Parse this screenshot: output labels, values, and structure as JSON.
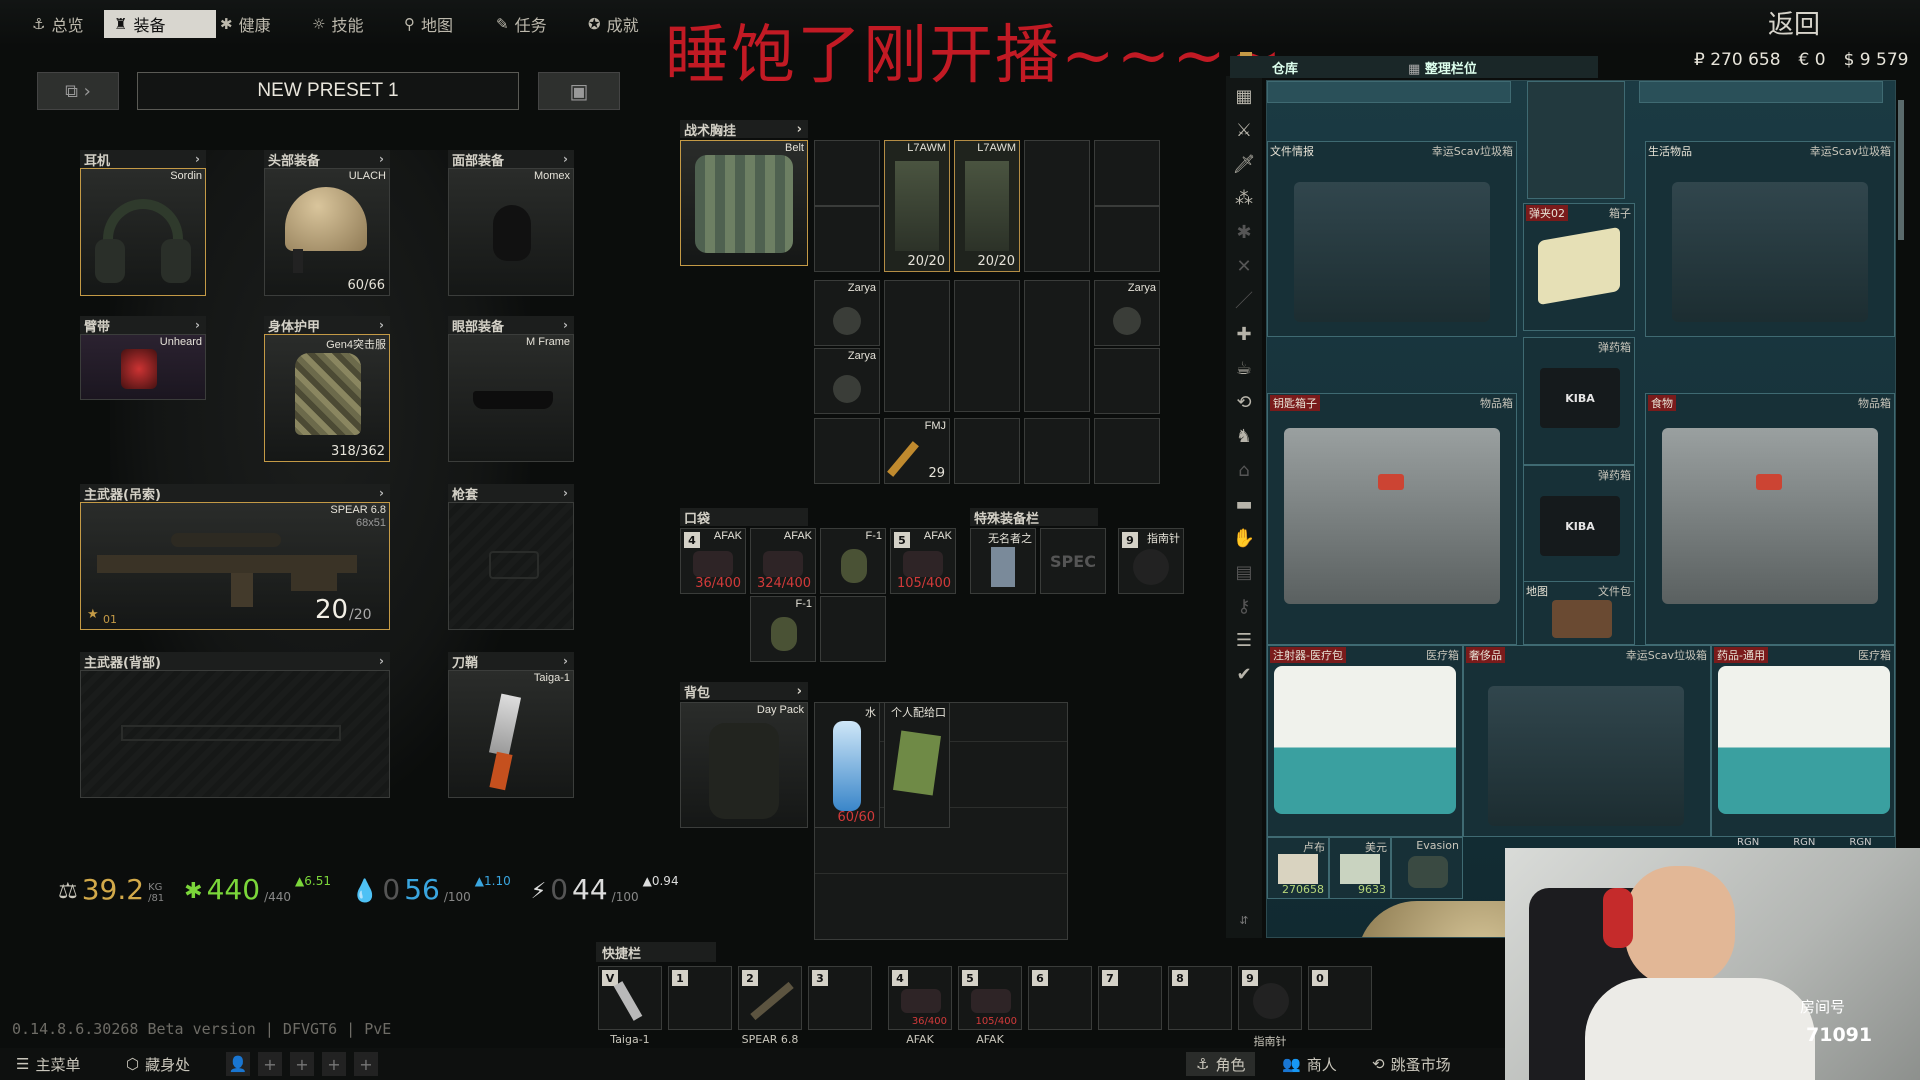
{
  "nav": {
    "tabs": [
      {
        "label": "总览",
        "icon": "anchor-icon"
      },
      {
        "label": "装备",
        "icon": "gear-person-icon"
      },
      {
        "label": "健康",
        "icon": "health-icon"
      },
      {
        "label": "技能",
        "icon": "skills-icon"
      },
      {
        "label": "地图",
        "icon": "map-pin-icon"
      },
      {
        "label": "任务",
        "icon": "task-icon"
      },
      {
        "label": "成就",
        "icon": "achievement-icon"
      }
    ],
    "back": "返回"
  },
  "stream_title": "睡饱了刚开播~~~~",
  "money": {
    "rub": "₽ 270 658",
    "eur": "€ 0",
    "usd": "$ 9 579"
  },
  "preset": {
    "name": "NEW PRESET 1"
  },
  "slots": {
    "earpiece": {
      "title": "耳机",
      "item": "Sordin"
    },
    "headwear": {
      "title": "头部装备",
      "item": "ULACH",
      "value": "60/66"
    },
    "facecover": {
      "title": "面部装备",
      "item": "Momex"
    },
    "armband": {
      "title": "臂带",
      "item": "Unheard"
    },
    "armor": {
      "title": "身体护甲",
      "item": "Gen4突击服",
      "value": "318/362"
    },
    "eyewear": {
      "title": "眼部装备",
      "item": "M Frame"
    },
    "primary_sling": {
      "title": "主武器(吊索)",
      "item": "SPEAR 6.8",
      "sub": "68x51",
      "ammo": "20",
      "ammo_max": "/20",
      "level": "01"
    },
    "holster": {
      "title": "枪套"
    },
    "primary_back": {
      "title": "主武器(背部)"
    },
    "scabbard": {
      "title": "刀鞘",
      "item": "Taiga-1"
    }
  },
  "rig": {
    "title": "战术胸挂",
    "item": "Belt",
    "mags": [
      {
        "name": "L7AWM",
        "value": "20/20"
      },
      {
        "name": "L7AWM",
        "value": "20/20"
      }
    ],
    "grenades": [
      "Zarya",
      "Zarya",
      "Zarya"
    ],
    "ammo": {
      "name": "FMJ",
      "count": "29"
    }
  },
  "pockets": {
    "title": "口袋",
    "items": [
      {
        "key": "4",
        "name": "AFAK",
        "value": "36/400"
      },
      {
        "name": "AFAK",
        "value": "324/400"
      },
      {
        "name": "F-1"
      },
      {
        "key": "5",
        "name": "AFAK",
        "value": "105/400"
      },
      {
        "name": "F-1"
      }
    ]
  },
  "special": {
    "title": "特殊装备栏",
    "items": [
      {
        "name": "无名者之"
      },
      {
        "name": "SPEC"
      },
      {
        "key": "9",
        "name": "指南针"
      }
    ]
  },
  "backpack": {
    "title": "背包",
    "item": "Day Pack",
    "water": {
      "name": "水",
      "value": "60/60"
    },
    "ration": {
      "name": "个人配给口"
    }
  },
  "stats": {
    "weight": "39.2",
    "weight_unit": "KG",
    "weight_max": "/81",
    "health": "440",
    "health_max": "/440",
    "health_delta": "▲6.51",
    "hydration": "56",
    "hydration_prefix": "0",
    "hydration_max": "/100",
    "hydration_delta": "▲1.10",
    "energy": "44",
    "energy_prefix": "0",
    "energy_max": "/100",
    "energy_delta": "▲0.94"
  },
  "stash": {
    "title": "仓库",
    "sort_tab": "整理栏位",
    "boxes": [
      {
        "left": "文件情报",
        "right": "幸运Scav垃圾箱"
      },
      {
        "left": "弹夹02",
        "right": "箱子"
      },
      {
        "left": "生活物品",
        "right": "幸运Scav垃圾箱"
      },
      {
        "left": "",
        "right": "弹药箱"
      },
      {
        "left": "钥匙箱子",
        "right": "物品箱"
      },
      {
        "left": "食物",
        "right": "物品箱"
      },
      {
        "left": "",
        "right": "弹药箱"
      },
      {
        "left": "地图",
        "right": "文件包"
      },
      {
        "left": "注射器-医疗包",
        "right": "医疗箱"
      },
      {
        "left": "奢侈品",
        "right": "幸运Scav垃圾箱"
      },
      {
        "left": "药品-通用",
        "right": "医疗箱"
      }
    ],
    "kiba": "KIBA",
    "money_items": [
      {
        "name": "卢布",
        "value": "270658"
      },
      {
        "name": "美元",
        "value": "9633"
      },
      {
        "name": "Evasion"
      }
    ],
    "rgn": [
      "RGN",
      "RGN",
      "RGN"
    ]
  },
  "quickbar": {
    "title": "快捷栏",
    "slots": [
      {
        "key": "V",
        "label": "Taiga-1"
      },
      {
        "key": "1",
        "label": ""
      },
      {
        "key": "2",
        "label": "SPEAR 6.8"
      },
      {
        "key": "3",
        "label": ""
      },
      {
        "key": "4",
        "label": "AFAK",
        "value": "36/400"
      },
      {
        "key": "5",
        "label": "AFAK",
        "value": "105/400"
      },
      {
        "key": "6",
        "label": ""
      },
      {
        "key": "7",
        "label": ""
      },
      {
        "key": "8",
        "label": ""
      },
      {
        "key": "9",
        "label": "指南针"
      },
      {
        "key": "0",
        "label": ""
      }
    ]
  },
  "version": "0.14.8.6.30268 Beta version | DFVGT6 | PvE",
  "bottombar": {
    "menu": "主菜单",
    "hideout": "藏身处",
    "character": "角色",
    "traders": "商人",
    "flea": "跳蚤市场"
  },
  "webcam": {
    "brand": "房间号",
    "room": "71091"
  },
  "colors": {
    "accent_gold": "#c49a46",
    "red_stream": "#c21a24",
    "stash_bg": "#1b3a43",
    "health_green": "#7bd63a",
    "water_blue": "#3aa6e0"
  }
}
